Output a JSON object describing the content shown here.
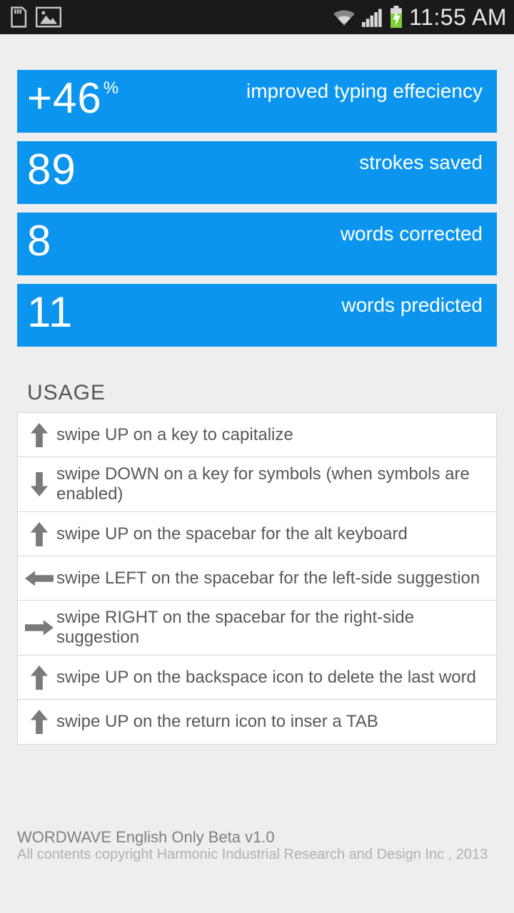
{
  "status_bar": {
    "time": "11:55 AM"
  },
  "stats": [
    {
      "prefix": "+",
      "value": "46",
      "suffix": "%",
      "label": "improved typing effeciency"
    },
    {
      "prefix": "",
      "value": "89",
      "suffix": "",
      "label": "strokes saved"
    },
    {
      "prefix": "",
      "value": "8",
      "suffix": "",
      "label": "words corrected"
    },
    {
      "prefix": "",
      "value": "11",
      "suffix": "",
      "label": "words predicted"
    }
  ],
  "usage": {
    "title": "USAGE",
    "items": [
      {
        "dir": "up",
        "text": "swipe UP on a key to capitalize"
      },
      {
        "dir": "down",
        "text": "swipe DOWN on a key for symbols (when symbols are enabled)"
      },
      {
        "dir": "up",
        "text": "swipe UP on the spacebar for the alt keyboard"
      },
      {
        "dir": "left",
        "text": "swipe LEFT on the spacebar for the left-side suggestion"
      },
      {
        "dir": "right",
        "text": "swipe RIGHT on the spacebar for the right-side suggestion"
      },
      {
        "dir": "up",
        "text": "swipe UP on the backspace icon to delete the last word"
      },
      {
        "dir": "up",
        "text": "swipe UP on the return icon to inser a TAB"
      }
    ]
  },
  "footer": {
    "line1": "WORDWAVE English Only Beta v1.0",
    "line2": "All contents copyright Harmonic Industrial Research and Design Inc , 2013"
  },
  "colors": {
    "accent": "#0b95ef",
    "bg": "#eeeeee"
  }
}
